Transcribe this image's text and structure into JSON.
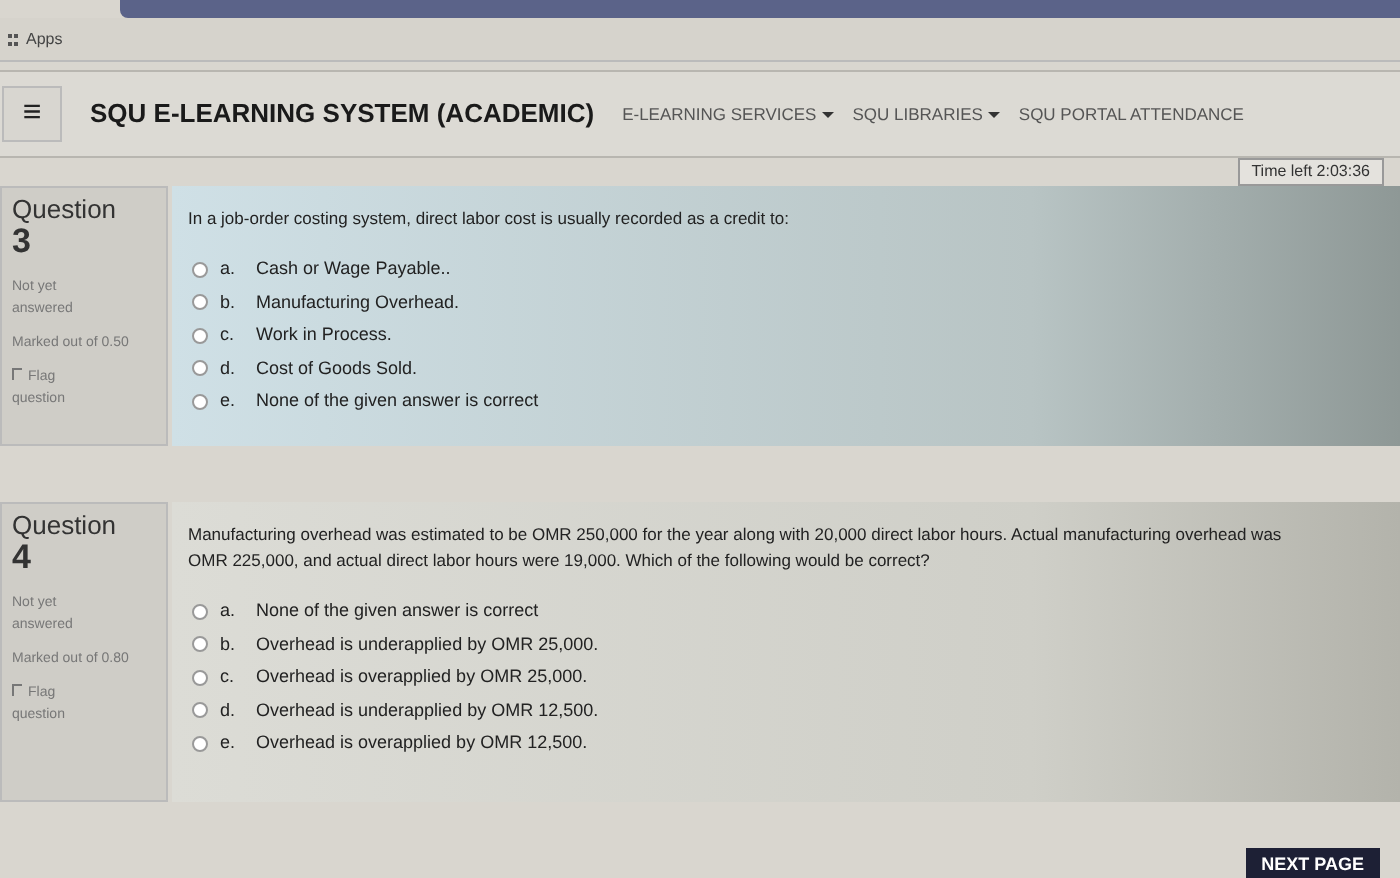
{
  "bookmarks_bar": {
    "items": [
      "Apps"
    ]
  },
  "navbar": {
    "menu_icon": "≡",
    "title": "SQU E-LEARNING SYSTEM (ACADEMIC)",
    "links": [
      {
        "label": "E-LEARNING SERVICES",
        "dropdown": true
      },
      {
        "label": "SQU LIBRARIES",
        "dropdown": true
      },
      {
        "label": "SQU PORTAL ATTENDANCE",
        "dropdown": false
      }
    ]
  },
  "timer": "Time left 2:03:36",
  "questions": [
    {
      "heading": "Question",
      "number": "3",
      "status": "Not yet answered",
      "marks": "Marked out of 0.50",
      "flag": "Flag question",
      "text": "In a job-order costing system, direct labor cost is usually recorded as a credit to:",
      "options": [
        {
          "letter": "a.",
          "text": "Cash or Wage Payable..",
          "selected": false
        },
        {
          "letter": "b.",
          "text": "Manufacturing Overhead.",
          "selected": false
        },
        {
          "letter": "c.",
          "text": "Work in Process.",
          "selected": false
        },
        {
          "letter": "d.",
          "text": "Cost of Goods Sold.",
          "selected": false
        },
        {
          "letter": "e.",
          "text": "None of the given answer is correct",
          "selected": false
        }
      ]
    },
    {
      "heading": "Question",
      "number": "4",
      "status": "Not yet answered",
      "marks": "Marked out of 0.80",
      "flag": "Flag question",
      "text": "Manufacturing overhead was estimated to be OMR 250,000 for the year along with 20,000 direct labor hours. Actual manufacturing overhead was OMR 225,000, and actual direct labor hours were 19,000. Which of the following would be correct?",
      "options": [
        {
          "letter": "a.",
          "text": "None of the given answer is correct",
          "selected": false
        },
        {
          "letter": "b.",
          "text": "Overhead is underapplied by OMR 25,000.",
          "selected": false
        },
        {
          "letter": "c.",
          "text": "Overhead is overapplied by OMR 25,000.",
          "selected": false
        },
        {
          "letter": "d.",
          "text": "Overhead is underapplied by OMR 12,500.",
          "selected": false
        },
        {
          "letter": "e.",
          "text": "Overhead is overapplied by OMR 12,500.",
          "selected": false
        }
      ]
    }
  ],
  "next_button": "NEXT PAGE"
}
